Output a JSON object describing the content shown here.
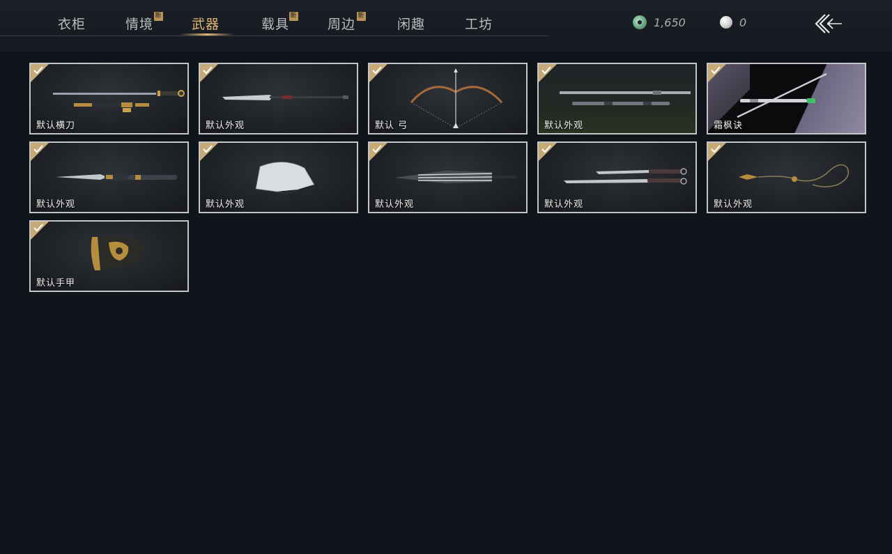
{
  "tabs": [
    {
      "label": "衣柜",
      "new": false,
      "active": false
    },
    {
      "label": "情境",
      "new": true,
      "active": false
    },
    {
      "label": "武器",
      "new": false,
      "active": true
    },
    {
      "label": "载具",
      "new": true,
      "active": false
    },
    {
      "label": "周边",
      "new": true,
      "active": false
    },
    {
      "label": "闲趣",
      "new": false,
      "active": false
    },
    {
      "label": "工坊",
      "new": false,
      "active": false
    }
  ],
  "badge_text": "新",
  "currency": {
    "coins": "1,650",
    "pearls": "0"
  },
  "items": [
    {
      "label": "默认横刀",
      "icon": "hengdao-sword-icon",
      "selected": true
    },
    {
      "label": "默认外观",
      "icon": "long-blade-icon",
      "selected": true
    },
    {
      "label": "默认 弓",
      "icon": "bow-icon",
      "selected": true
    },
    {
      "label": "默认外观",
      "icon": "twin-sword-icon",
      "selected": true
    },
    {
      "label": "霜枫诀",
      "icon": "frost-maple-sword-icon",
      "selected": true
    },
    {
      "label": "默认外观",
      "icon": "dagger-icon",
      "selected": true
    },
    {
      "label": "默认外观",
      "icon": "fan-icon",
      "selected": true
    },
    {
      "label": "默认外观",
      "icon": "umbrella-icon",
      "selected": true
    },
    {
      "label": "默认外观",
      "icon": "dual-blades-icon",
      "selected": true
    },
    {
      "label": "默认外观",
      "icon": "rope-dart-icon",
      "selected": true
    },
    {
      "label": "默认手甲",
      "icon": "gauntlet-icon",
      "selected": true
    }
  ],
  "colors": {
    "accent": "#e2b776",
    "check": "#c6ab78",
    "background": "#10141b"
  }
}
